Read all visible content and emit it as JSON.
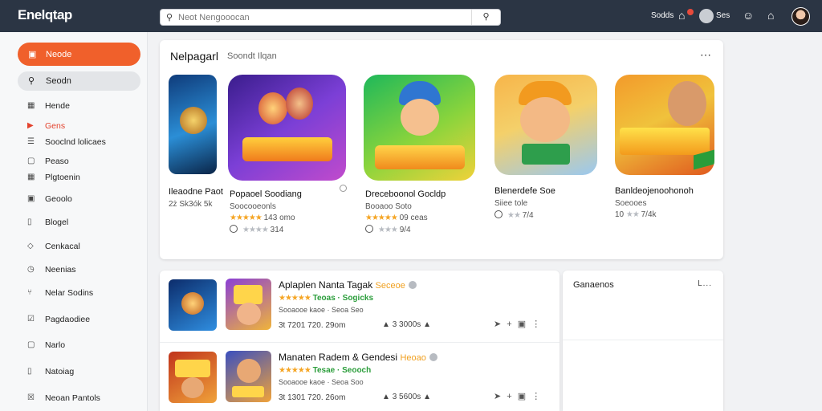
{
  "app": {
    "brand": "Enelqtap"
  },
  "search": {
    "placeholder": "Neot Nengooocan"
  },
  "topbar": {
    "label1": "Sodds",
    "label2": "Ses"
  },
  "sidebar": {
    "primary": "Neode",
    "search": "Seodn",
    "items": [
      {
        "label": "Hende",
        "icon": "grid-icon"
      },
      {
        "label": "Gens",
        "icon": "play-icon",
        "color": "#e3422d"
      },
      {
        "label": "Sooclnd lolicaes",
        "icon": "list-icon"
      },
      {
        "label": "Peaso",
        "icon": "box-icon"
      },
      {
        "label": "Plgtoenin",
        "icon": "grid-icon"
      },
      {
        "label": "Geoolo",
        "icon": "card-icon"
      },
      {
        "label": "Blogel",
        "icon": "doc-icon"
      },
      {
        "label": "Cenkacal",
        "icon": "tag-icon"
      },
      {
        "label": "Neenias",
        "icon": "clock-icon"
      },
      {
        "label": "Nelar Sodins",
        "icon": "share-icon"
      },
      {
        "label": "Pagdaodiee",
        "icon": "check-icon"
      },
      {
        "label": "Narlo",
        "icon": "box-icon"
      },
      {
        "label": "Natoiag",
        "icon": "doc-icon"
      },
      {
        "label": "Neoan Pantols",
        "icon": "close-icon"
      }
    ]
  },
  "featured": {
    "title": "Nelpagarl",
    "subtitle": "Soondt Ilqan",
    "games": [
      {
        "name": "Ileaodne Paot",
        "meta": "2ż Sk3ók 5k",
        "rating": ""
      },
      {
        "name": "Popaoel Soodiang",
        "meta": "Soocooeonls",
        "rating": "143 omo",
        "rating2": "314"
      },
      {
        "name": "Dreceboonol Gocldp",
        "meta": "Booaoo Soto",
        "rating": "09 ceas",
        "rating2": "9/4"
      },
      {
        "name": "Blenerdefe Soe",
        "meta": "Siiee tole",
        "rating": "",
        "rating2": "7/4"
      },
      {
        "name": "Banldeojenoohonoh",
        "meta": "Soeooes",
        "rating": "",
        "rating2": "7/4k",
        "prefix": "10"
      }
    ]
  },
  "list": {
    "rows": [
      {
        "title": "Aplaplen Nanta Tagak",
        "tag": "Seceoe",
        "rating": "Teoas · Sogicks",
        "category": "Sooaooe kaoe · Seoa Seo",
        "size": "3t 7201 720. 29om",
        "downloads": "3 3000s"
      },
      {
        "title": "Manaten Radem & Gendesi",
        "tag": "Heoao",
        "rating": "Tesae · Seooch",
        "category": "Sooaooe kaoe · Seoa Soo",
        "size": "3t 1301 720. 26om",
        "downloads": "3 5600s"
      }
    ]
  },
  "side_panel": {
    "header": "Ganaenos",
    "more": "L..."
  },
  "colors": {
    "accent": "#f0602b",
    "topbar": "#2b3544",
    "star": "#f5a524",
    "tag_green": "#2a9d3a"
  }
}
